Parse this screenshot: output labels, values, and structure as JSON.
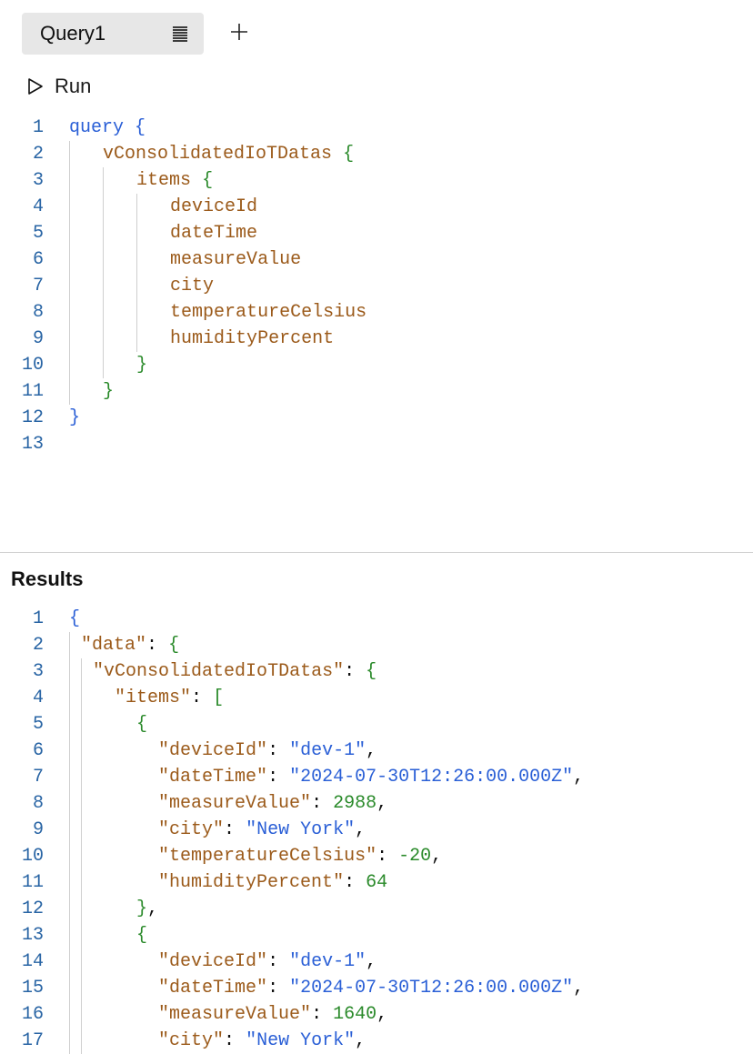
{
  "tab": {
    "label": "Query1",
    "icon": "lines-icon"
  },
  "add_icon": "+",
  "run": {
    "label": "Run"
  },
  "results": {
    "label": "Results"
  },
  "query": {
    "lines": [
      "query {",
      "    vConsolidatedIoTDatas {",
      "        items {",
      "            deviceId",
      "            dateTime",
      "            measureValue",
      "            city",
      "            temperatureCelsius",
      "            humidityPercent",
      "        }",
      "    }",
      "}",
      ""
    ],
    "root": "query",
    "field_root": "vConsolidatedIoTDatas",
    "items_key": "items",
    "fields": [
      "deviceId",
      "dateTime",
      "measureValue",
      "city",
      "temperatureCelsius",
      "humidityPercent"
    ]
  },
  "results_json": {
    "data": {
      "vConsolidatedIoTDatas": {
        "items": [
          {
            "deviceId": "dev-1",
            "dateTime": "2024-07-30T12:26:00.000Z",
            "measureValue": 2988,
            "city": "New York",
            "temperatureCelsius": -20,
            "humidityPercent": 64
          },
          {
            "deviceId": "dev-1",
            "dateTime": "2024-07-30T12:26:00.000Z",
            "measureValue": 1640,
            "city": "New York"
          }
        ]
      }
    }
  },
  "tokens": {
    "open_brace": "{",
    "close_brace": "}",
    "open_bracket": "[",
    "close_bracket": "]",
    "colon": ":",
    "comma": ","
  }
}
